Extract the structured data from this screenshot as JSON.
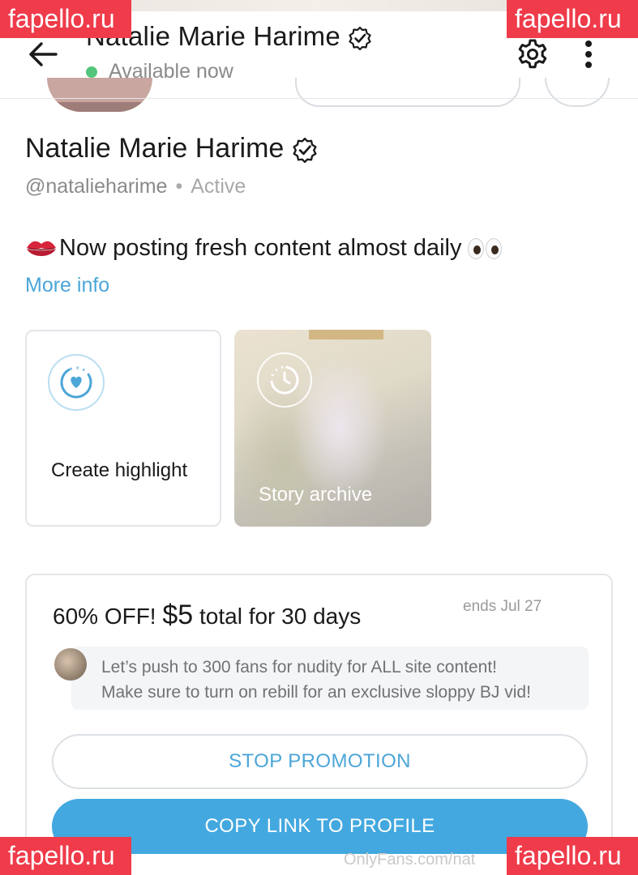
{
  "header": {
    "name": "Natalie Marie Harime",
    "status": "Available now",
    "back_icon": "arrow-left-icon",
    "settings_icon": "gear-icon",
    "more_icon": "vertical-dots-icon"
  },
  "profile": {
    "name": "Natalie Marie Harime",
    "handle": "@natalieharime",
    "separator": "•",
    "activity": "Active",
    "bio": "Now posting fresh content almost daily",
    "more_info": "More info"
  },
  "highlights": {
    "create_label": "Create highlight",
    "archive_label": "Story archive"
  },
  "promo": {
    "title_prefix": "60% OFF!",
    "price": "$5",
    "title_suffix": "total for 30 days",
    "ends": "ends Jul 27",
    "message_line1": "Let’s push to 300 fans for nudity for ALL site content!",
    "message_line2": "Make sure to turn on rebill for an exclusive sloppy BJ vid!",
    "stop_button": "STOP PROMOTION",
    "copy_button": "COPY LINK TO PROFILE"
  },
  "footer": {
    "url_text": "OnlyFans.com/nat"
  },
  "watermarks": {
    "text": "fapello.ru",
    "color": "#ef3b4a"
  },
  "colors": {
    "accent": "#43a8df",
    "link": "#4ca6d8",
    "online": "#53c57d"
  }
}
